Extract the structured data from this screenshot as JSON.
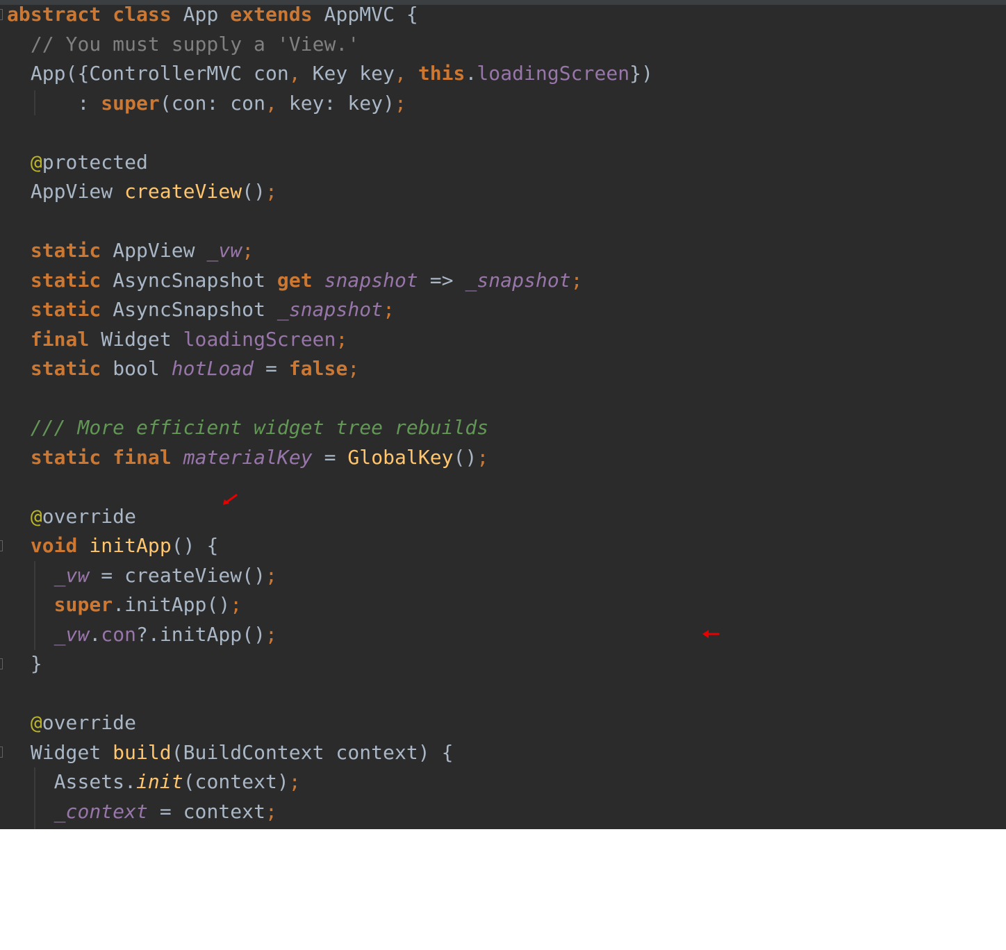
{
  "editor": {
    "background_color": "#2b2b2b",
    "annotation_arrow_color": "#e60000",
    "lines": [
      {
        "tokens": [
          {
            "t": "abstract",
            "c": "kw"
          },
          {
            "t": " ",
            "c": ""
          },
          {
            "t": "class",
            "c": "kw"
          },
          {
            "t": " App ",
            "c": ""
          },
          {
            "t": "extends",
            "c": "kw"
          },
          {
            "t": " AppMVC {",
            "c": ""
          }
        ]
      },
      {
        "tokens": [
          {
            "t": "  // You must supply a 'View.'",
            "c": "com"
          }
        ]
      },
      {
        "tokens": [
          {
            "t": "  App({ControllerMVC con",
            "c": ""
          },
          {
            "t": ",",
            "c": "pn"
          },
          {
            "t": " Key key",
            "c": ""
          },
          {
            "t": ",",
            "c": "pn"
          },
          {
            "t": " ",
            "c": ""
          },
          {
            "t": "this",
            "c": "kw"
          },
          {
            "t": ".",
            "c": ""
          },
          {
            "t": "loadingScreen",
            "c": "fld"
          },
          {
            "t": "})",
            "c": ""
          }
        ]
      },
      {
        "tokens": [
          {
            "t": "      : ",
            "c": ""
          },
          {
            "t": "super",
            "c": "kw"
          },
          {
            "t": "(con: con",
            "c": ""
          },
          {
            "t": ",",
            "c": "pn"
          },
          {
            "t": " key: key)",
            "c": ""
          },
          {
            "t": ";",
            "c": "pn"
          }
        ]
      },
      {
        "tokens": []
      },
      {
        "tokens": [
          {
            "t": "  @",
            "c": "ann"
          },
          {
            "t": "protected",
            "c": ""
          }
        ]
      },
      {
        "tokens": [
          {
            "t": "  AppView ",
            "c": ""
          },
          {
            "t": "createView",
            "c": "fn"
          },
          {
            "t": "()",
            "c": ""
          },
          {
            "t": ";",
            "c": "pn"
          }
        ]
      },
      {
        "tokens": []
      },
      {
        "tokens": [
          {
            "t": "  ",
            "c": ""
          },
          {
            "t": "static",
            "c": "kw"
          },
          {
            "t": " AppView ",
            "c": ""
          },
          {
            "t": "_vw",
            "c": "sfld"
          },
          {
            "t": ";",
            "c": "pn"
          }
        ]
      },
      {
        "tokens": [
          {
            "t": "  ",
            "c": ""
          },
          {
            "t": "static",
            "c": "kw"
          },
          {
            "t": " AsyncSnapshot ",
            "c": ""
          },
          {
            "t": "get",
            "c": "kw"
          },
          {
            "t": " ",
            "c": ""
          },
          {
            "t": "snapshot",
            "c": "sfld"
          },
          {
            "t": " => ",
            "c": ""
          },
          {
            "t": "_snapshot",
            "c": "sfld"
          },
          {
            "t": ";",
            "c": "pn"
          }
        ]
      },
      {
        "tokens": [
          {
            "t": "  ",
            "c": ""
          },
          {
            "t": "static",
            "c": "kw"
          },
          {
            "t": " AsyncSnapshot ",
            "c": ""
          },
          {
            "t": "_snapshot",
            "c": "sfld"
          },
          {
            "t": ";",
            "c": "pn"
          }
        ]
      },
      {
        "tokens": [
          {
            "t": "  ",
            "c": ""
          },
          {
            "t": "final",
            "c": "kw"
          },
          {
            "t": " Widget ",
            "c": ""
          },
          {
            "t": "loadingScreen",
            "c": "fld"
          },
          {
            "t": ";",
            "c": "pn"
          }
        ]
      },
      {
        "tokens": [
          {
            "t": "  ",
            "c": ""
          },
          {
            "t": "static",
            "c": "kw"
          },
          {
            "t": " bool ",
            "c": ""
          },
          {
            "t": "hotLoad",
            "c": "sfld"
          },
          {
            "t": " = ",
            "c": ""
          },
          {
            "t": "false",
            "c": "kw"
          },
          {
            "t": ";",
            "c": "pn"
          }
        ]
      },
      {
        "tokens": []
      },
      {
        "tokens": [
          {
            "t": "  /// More efficient widget tree rebuilds",
            "c": "doc"
          }
        ]
      },
      {
        "tokens": [
          {
            "t": "  ",
            "c": ""
          },
          {
            "t": "static",
            "c": "kw"
          },
          {
            "t": " ",
            "c": ""
          },
          {
            "t": "final",
            "c": "kw"
          },
          {
            "t": " ",
            "c": ""
          },
          {
            "t": "materialKey",
            "c": "sfld"
          },
          {
            "t": " = ",
            "c": ""
          },
          {
            "t": "GlobalKey",
            "c": "fn"
          },
          {
            "t": "()",
            "c": ""
          },
          {
            "t": ";",
            "c": "pn"
          }
        ]
      },
      {
        "tokens": []
      },
      {
        "tokens": [
          {
            "t": "  @",
            "c": "ann"
          },
          {
            "t": "override",
            "c": ""
          }
        ]
      },
      {
        "tokens": [
          {
            "t": "  ",
            "c": ""
          },
          {
            "t": "void",
            "c": "kw"
          },
          {
            "t": " ",
            "c": ""
          },
          {
            "t": "initApp",
            "c": "fn"
          },
          {
            "t": "() {",
            "c": ""
          }
        ]
      },
      {
        "tokens": [
          {
            "t": "    ",
            "c": ""
          },
          {
            "t": "_vw",
            "c": "sfld"
          },
          {
            "t": " = createView()",
            "c": ""
          },
          {
            "t": ";",
            "c": "pn"
          }
        ]
      },
      {
        "tokens": [
          {
            "t": "    ",
            "c": ""
          },
          {
            "t": "super",
            "c": "kw"
          },
          {
            "t": ".initApp()",
            "c": ""
          },
          {
            "t": ";",
            "c": "pn"
          }
        ]
      },
      {
        "tokens": [
          {
            "t": "    ",
            "c": ""
          },
          {
            "t": "_vw",
            "c": "sfld"
          },
          {
            "t": ".",
            "c": ""
          },
          {
            "t": "con",
            "c": "fld"
          },
          {
            "t": "?.initApp()",
            "c": ""
          },
          {
            "t": ";",
            "c": "pn"
          }
        ]
      },
      {
        "tokens": [
          {
            "t": "  }",
            "c": ""
          }
        ]
      },
      {
        "tokens": []
      },
      {
        "tokens": [
          {
            "t": "  @",
            "c": "ann"
          },
          {
            "t": "override",
            "c": ""
          }
        ]
      },
      {
        "tokens": [
          {
            "t": "  Widget ",
            "c": ""
          },
          {
            "t": "build",
            "c": "fn"
          },
          {
            "t": "(BuildContext context) {",
            "c": ""
          }
        ]
      },
      {
        "tokens": [
          {
            "t": "    Assets.",
            "c": ""
          },
          {
            "t": "init",
            "c": "fn-it"
          },
          {
            "t": "(context)",
            "c": ""
          },
          {
            "t": ";",
            "c": "pn"
          }
        ]
      },
      {
        "tokens": [
          {
            "t": "    ",
            "c": ""
          },
          {
            "t": "_context",
            "c": "sfld"
          },
          {
            "t": " = context",
            "c": ""
          },
          {
            "t": ";",
            "c": "pn"
          }
        ]
      }
    ]
  }
}
